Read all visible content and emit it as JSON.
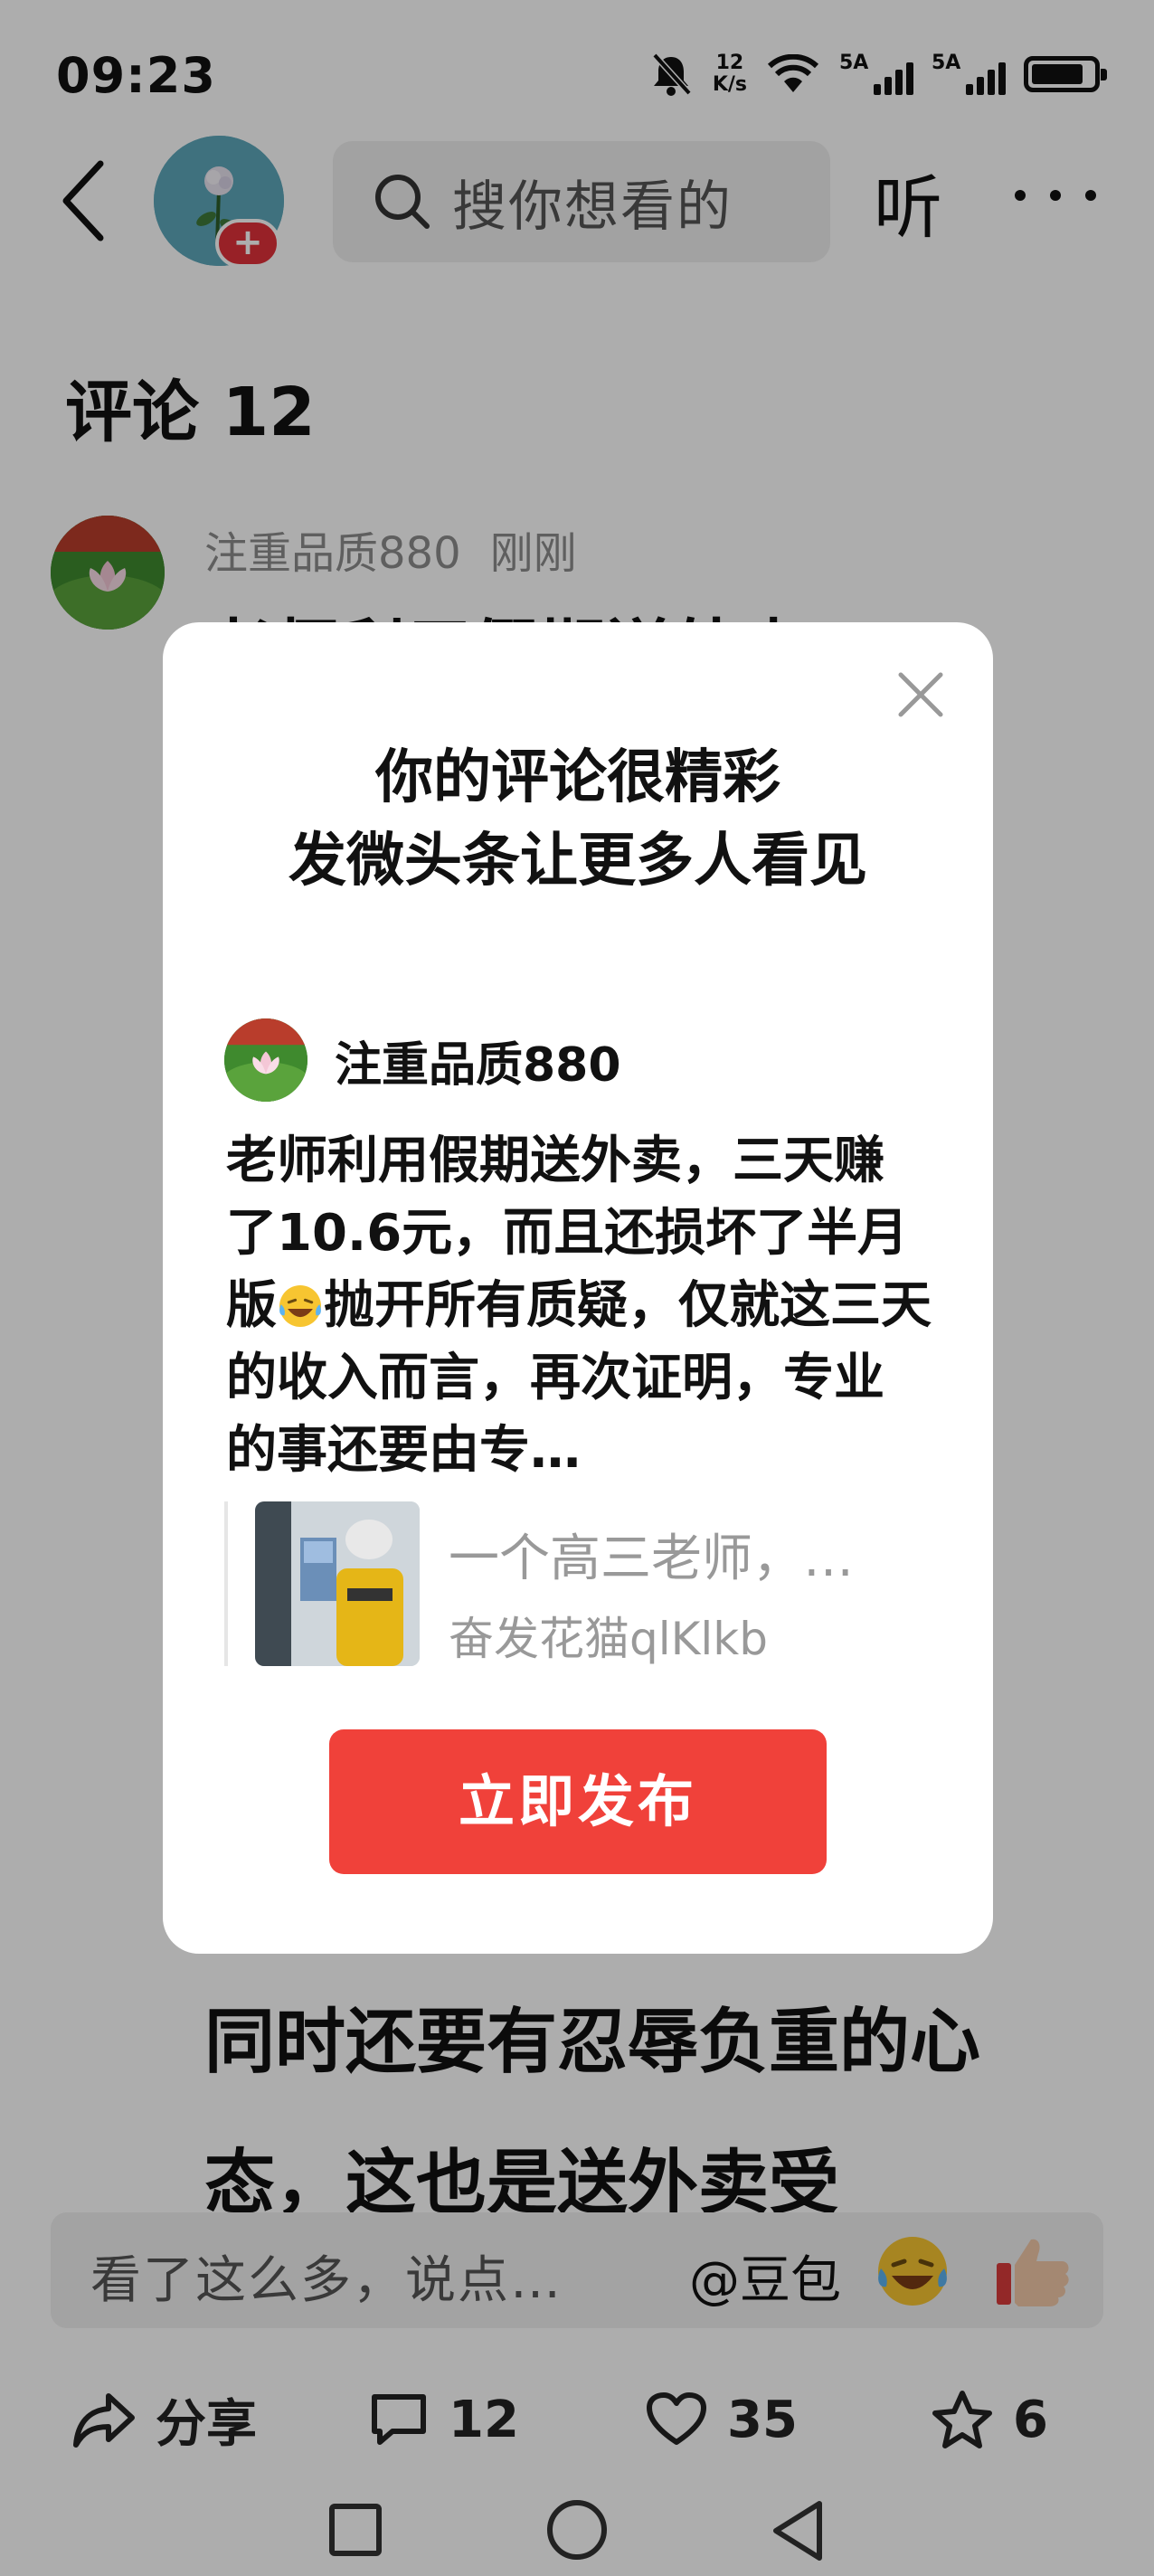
{
  "status_bar": {
    "time": "09:23",
    "net_speed_value": "12",
    "net_speed_unit": "K/s",
    "sim1_label": "5A",
    "sim2_label": "5A"
  },
  "header": {
    "search_placeholder": "搜你想看的",
    "listen_label": "听"
  },
  "comments": {
    "title": "评论 12",
    "item": {
      "author": "注重品质880",
      "time": "刚刚",
      "text_top": "老师利用假期送外卖",
      "text_bottom": "同时还要有忍辱负重的心态，这也是送外卖受"
    }
  },
  "dialog": {
    "title_line1": "你的评论很精彩",
    "title_line2": "发微头条让更多人看见",
    "author": "注重品质880",
    "text_part1": "老师利用假期送外卖，三天赚了10.6元，而且还损坏了半月版",
    "text_part2": "抛开所有质疑，仅就这三天的收入而言，再次证明，专业的事还要由专…",
    "card_title": "一个高三老师，…",
    "card_author": "奋发花猫qlKlkb",
    "publish_label": "立即发布"
  },
  "input_bar": {
    "placeholder": "看了这么多，说点…",
    "mention": "@豆包"
  },
  "actions": {
    "share_label": "分享",
    "comment_count": "12",
    "like_count": "35",
    "favorite_count": "6"
  },
  "colors": {
    "accent": "#f0413a",
    "badge": "#e0323a",
    "overlay": "rgba(0,0,0,0.32)"
  }
}
